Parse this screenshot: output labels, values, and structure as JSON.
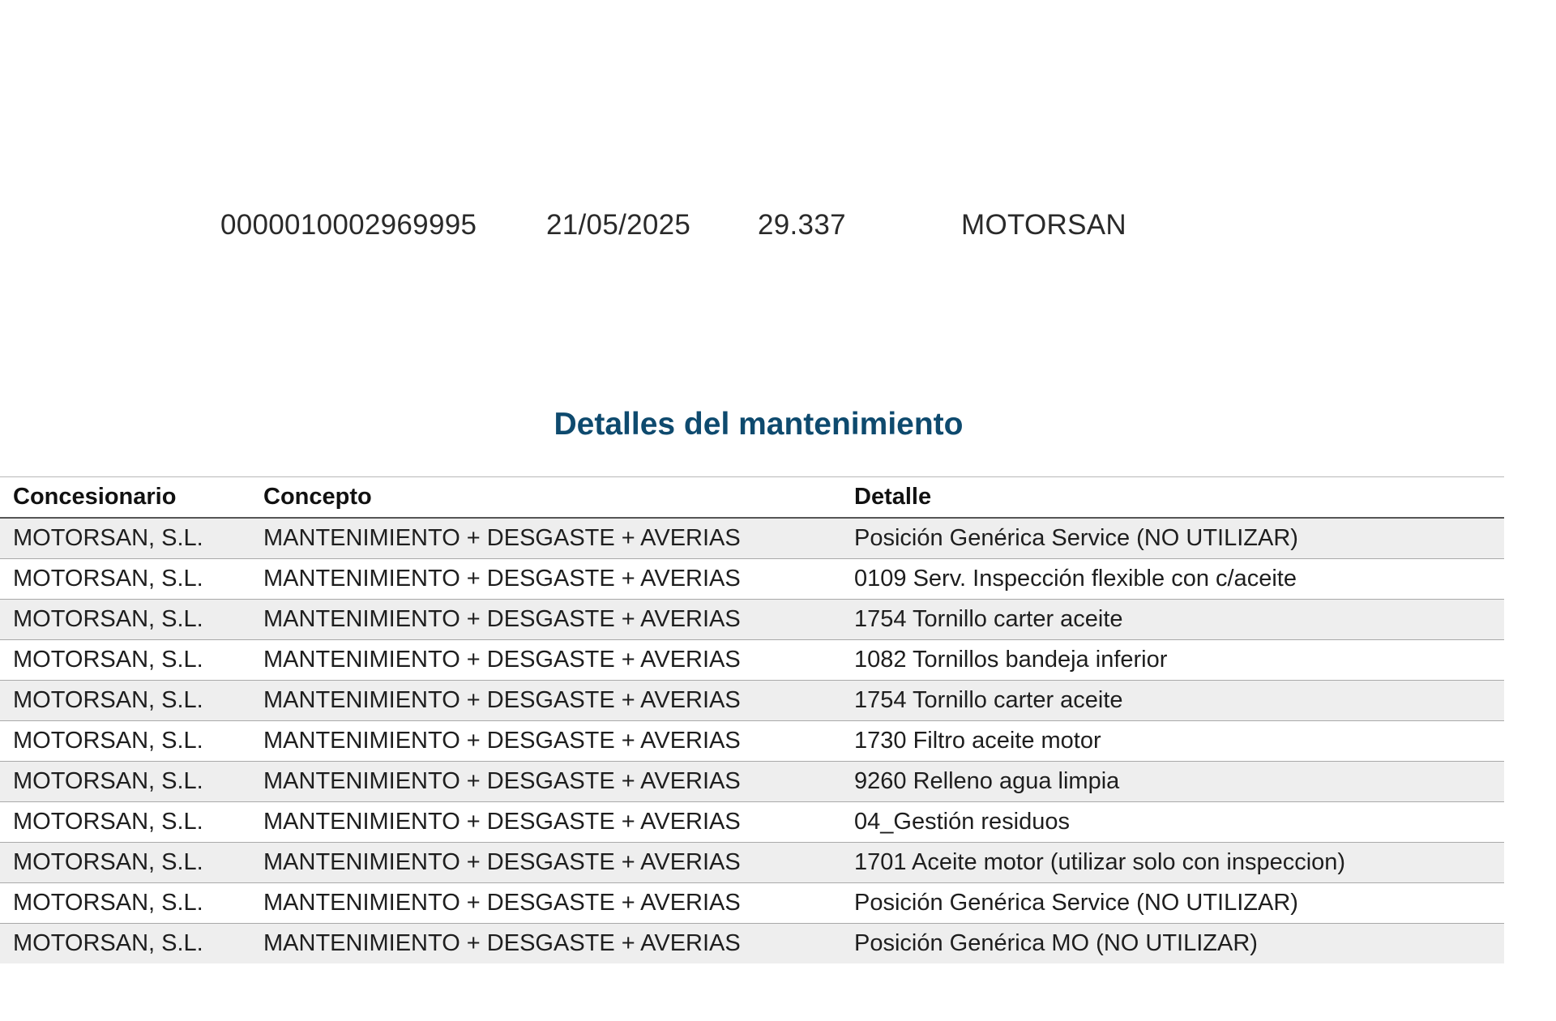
{
  "summary": {
    "number": "0000010002969995",
    "date": "21/05/2025",
    "mileage": "29.337",
    "dealer": "MOTORSAN"
  },
  "section_title": "Detalles del mantenimiento",
  "table": {
    "headers": [
      "Concesionario",
      "Concepto",
      "Detalle"
    ],
    "rows": [
      [
        "MOTORSAN, S.L.",
        "MANTENIMIENTO + DESGASTE + AVERIAS",
        "Posición Genérica Service (NO UTILIZAR)"
      ],
      [
        "MOTORSAN, S.L.",
        "MANTENIMIENTO + DESGASTE + AVERIAS",
        "0109 Serv. Inspección flexible con c/aceite"
      ],
      [
        "MOTORSAN, S.L.",
        "MANTENIMIENTO + DESGASTE + AVERIAS",
        "1754 Tornillo carter aceite"
      ],
      [
        "MOTORSAN, S.L.",
        "MANTENIMIENTO + DESGASTE + AVERIAS",
        "1082 Tornillos bandeja inferior"
      ],
      [
        "MOTORSAN, S.L.",
        "MANTENIMIENTO + DESGASTE + AVERIAS",
        "1754 Tornillo carter aceite"
      ],
      [
        "MOTORSAN, S.L.",
        "MANTENIMIENTO + DESGASTE + AVERIAS",
        "1730 Filtro aceite motor"
      ],
      [
        "MOTORSAN, S.L.",
        "MANTENIMIENTO + DESGASTE + AVERIAS",
        "9260 Relleno agua limpia"
      ],
      [
        "MOTORSAN, S.L.",
        "MANTENIMIENTO + DESGASTE + AVERIAS",
        "04_Gestión residuos"
      ],
      [
        "MOTORSAN, S.L.",
        "MANTENIMIENTO + DESGASTE + AVERIAS",
        "1701 Aceite motor (utilizar solo con inspeccion)"
      ],
      [
        "MOTORSAN, S.L.",
        "MANTENIMIENTO + DESGASTE + AVERIAS",
        "Posición Genérica Service (NO UTILIZAR)"
      ],
      [
        "MOTORSAN, S.L.",
        "MANTENIMIENTO + DESGASTE + AVERIAS",
        "Posición Genérica MO (NO UTILIZAR)"
      ]
    ]
  }
}
